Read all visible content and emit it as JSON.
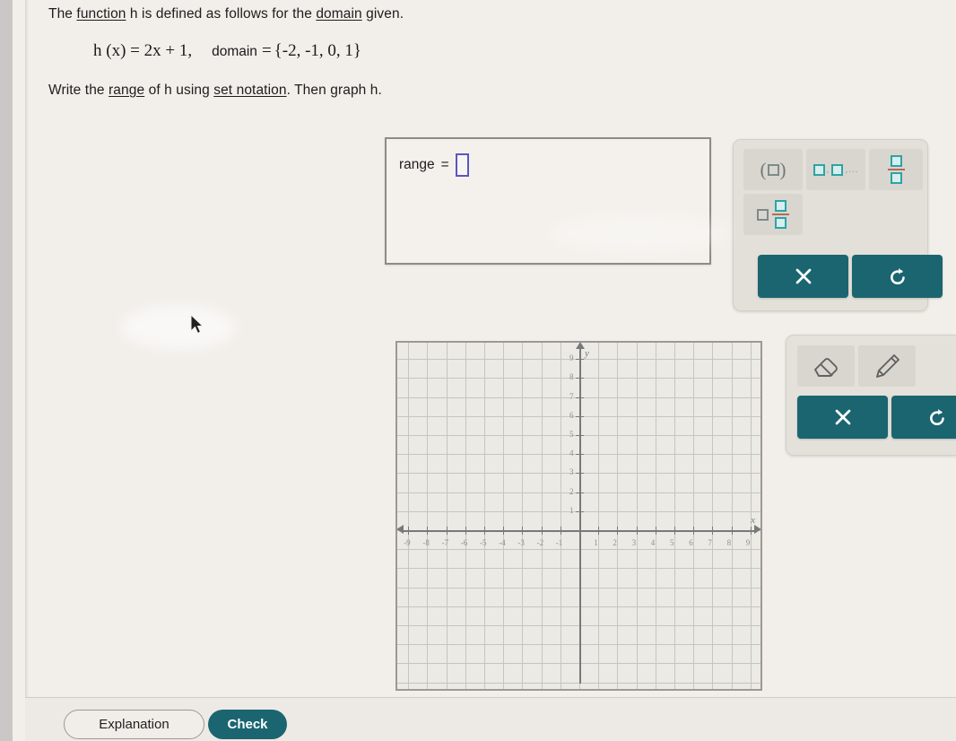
{
  "problem": {
    "line1_a": "The ",
    "line1_function": "function",
    "line1_b": " h is defined as follows for the ",
    "line1_domain": "domain",
    "line1_c": " given.",
    "equation": "h (x) = 2x + 1,",
    "domain_label": "domain",
    "domain_eq": "=",
    "domain_set": "{-2, -1, 0, 1}",
    "line3_a": "Write the ",
    "line3_range": "range",
    "line3_b": " of h using ",
    "line3_setnotation": "set notation",
    "line3_c": ". Then graph h."
  },
  "answer": {
    "range_label": "range",
    "equals": "=",
    "input_value": "",
    "input_placeholder": ""
  },
  "keypad": {
    "set_notation_label": "{□}",
    "list_label": "□,□,...",
    "fraction_label": "□/□",
    "mixed_number_label": "□ □/□",
    "clear_label": "×",
    "undo_label": "↺",
    "list_dots": ",..."
  },
  "graph_tools": {
    "eraser_label": "eraser",
    "pencil_label": "pencil",
    "clear_label": "×",
    "undo_label": "↺"
  },
  "footer": {
    "explanation_label": "Explanation",
    "check_label": "Check"
  },
  "colors": {
    "teal": "#1a6570",
    "input_outline": "#5b55c4",
    "page_bg": "#f2efea",
    "panel_bg": "#e3e0da",
    "key_bg": "#d9d6d0",
    "grid_line": "#c3c6c4",
    "axis": "#77797a"
  },
  "chart_data": {
    "type": "scatter",
    "title": "",
    "xlabel": "x",
    "ylabel": "y",
    "xlim": [
      -10,
      10
    ],
    "ylim": [
      -5,
      10
    ],
    "xticks": [
      -9,
      -8,
      -7,
      -6,
      -5,
      -4,
      -3,
      -2,
      -1,
      1,
      2,
      3,
      4,
      5,
      6,
      7,
      8,
      9
    ],
    "yticks": [
      1,
      2,
      3,
      4,
      5,
      6,
      7,
      8,
      9
    ],
    "xtick_labels": [
      "-9",
      "-8",
      "-7",
      "-6",
      "-5",
      "-4",
      "-3",
      "-2",
      "-1",
      "1",
      "2",
      "3",
      "4",
      "5",
      "6",
      "7",
      "8",
      "9"
    ],
    "ytick_labels": [
      "1",
      "2",
      "3",
      "4",
      "5",
      "6",
      "7",
      "8",
      "9"
    ],
    "grid": true,
    "legend": false,
    "series": [
      {
        "name": "h(x) = 2x + 1",
        "points": []
      }
    ]
  }
}
